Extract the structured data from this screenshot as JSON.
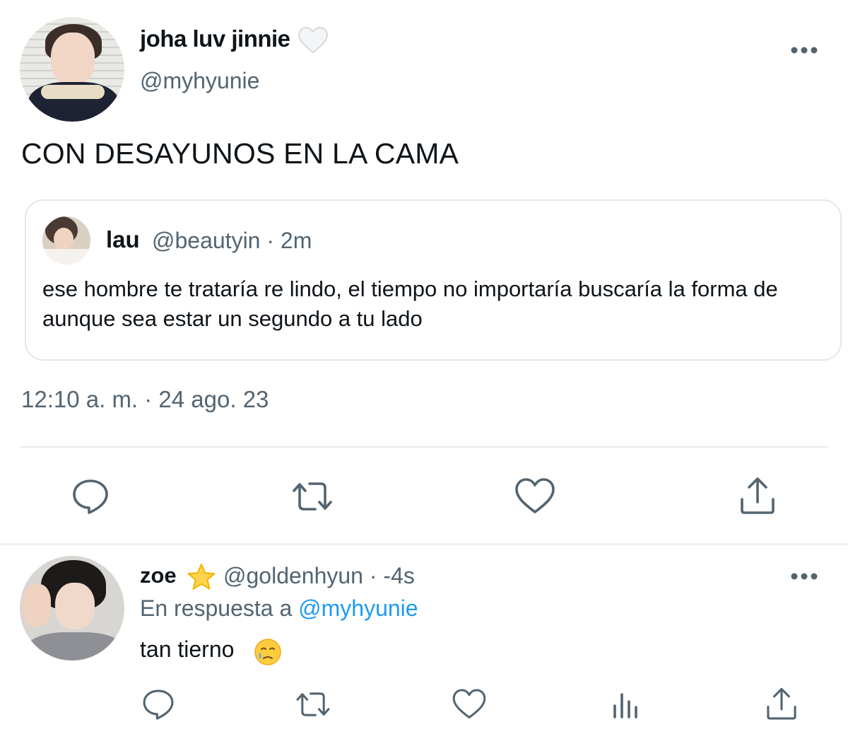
{
  "main_tweet": {
    "display_name": "joha luv jinnie",
    "name_emoji": "white-heart-emoji",
    "handle": "@myhyunie",
    "text": "CON DESAYUNOS EN LA CAMA",
    "timestamp": "12:10 a. m. · 24 ago. 23",
    "quoted": {
      "display_name": "lau",
      "meta": "@beautyin · 2m",
      "text": "ese hombre te trataría re lindo, el tiempo no importaría buscaría la forma de aunque sea estar un segundo a tu lado"
    },
    "actions": [
      "reply-icon",
      "retweet-icon",
      "like-icon",
      "share-icon"
    ]
  },
  "reply_tweet": {
    "display_name": "zoe",
    "name_emoji": "star-emoji",
    "meta": "@goldenhyun · -4s",
    "reply_prefix": "En respuesta a",
    "reply_mention": "@myhyunie",
    "text": "tan tierno",
    "text_emoji": "face-holding-back-tears-emoji",
    "actions": [
      "reply-icon",
      "retweet-icon",
      "like-icon",
      "views-icon",
      "share-icon"
    ]
  },
  "colors": {
    "text": "#0f1419",
    "secondary": "#536471",
    "link": "#1d9bf0",
    "border": "#e1e8ed"
  }
}
